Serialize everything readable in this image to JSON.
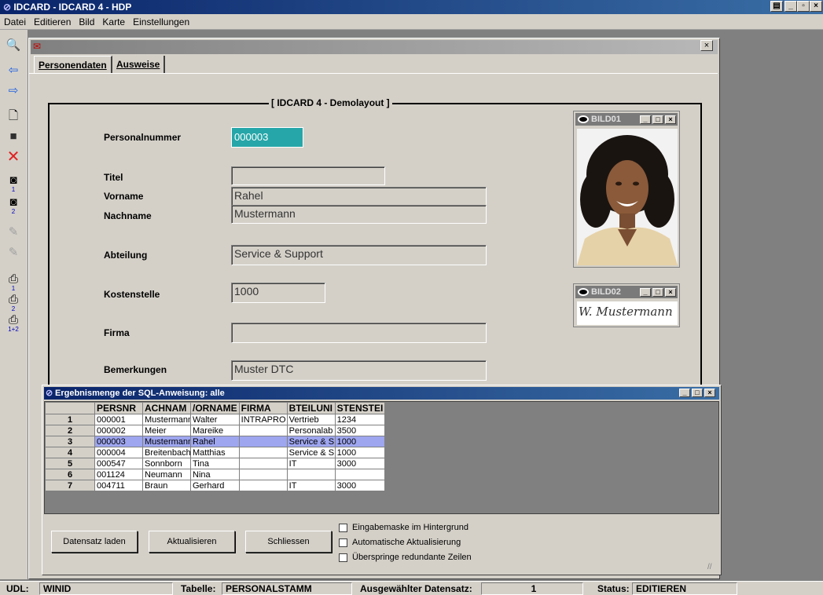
{
  "window": {
    "title": "IDCARD - IDCARD 4 - HDP"
  },
  "menu": {
    "items": [
      "Datei",
      "Editieren",
      "Bild",
      "Karte",
      "Einstellungen"
    ]
  },
  "tabs": [
    "Personendaten",
    "Ausweise"
  ],
  "form": {
    "frame_title": "[ IDCARD 4 - Demolayout ]",
    "personalnummer_label": "Personalnummer",
    "personalnummer": "000003",
    "titel_label": "Titel",
    "titel": "",
    "vorname_label": "Vorname",
    "vorname": "Rahel",
    "nachname_label": "Nachname",
    "nachname": "Mustermann",
    "abteilung_label": "Abteilung",
    "abteilung": "Service & Support",
    "kostenstelle_label": "Kostenstelle",
    "kostenstelle": "1000",
    "firma_label": "Firma",
    "firma": "",
    "bemerkungen_label": "Bemerkungen",
    "bemerkungen": "Muster DTC"
  },
  "images": {
    "bild01": "BILD01",
    "bild02": "BILD02",
    "signature": "W. Mustermann"
  },
  "dialog": {
    "title": "Ergebnismenge der SQL-Anweisung: alle",
    "columns": [
      "PERSNR",
      "ACHNAM",
      "/ORNAME",
      "FIRMA",
      "BTEILUNI",
      "STENSTEI"
    ],
    "rows": [
      [
        "1",
        "000001",
        "Mustermann",
        "Walter",
        "INTRAPRO",
        "Vertrieb",
        "1234"
      ],
      [
        "2",
        "000002",
        "Meier",
        "Mareike",
        "",
        "Personalab",
        "3500"
      ],
      [
        "3",
        "000003",
        "Mustermann",
        "Rahel",
        "",
        "Service & S",
        "1000"
      ],
      [
        "4",
        "000004",
        "Breitenbach",
        "Matthias",
        "",
        "Service & S",
        "1000"
      ],
      [
        "5",
        "000547",
        "Sonnborn",
        "Tina",
        "",
        "IT",
        "3000"
      ],
      [
        "6",
        "001124",
        "Neumann",
        "Nina",
        "",
        "",
        ""
      ],
      [
        "7",
        "004711",
        "Braun",
        "Gerhard",
        "",
        "IT",
        "3000"
      ]
    ],
    "selected_row": 2,
    "buttons": {
      "laden": "Datensatz laden",
      "aktualisieren": "Aktualisieren",
      "schliessen": "Schliessen"
    },
    "checkboxes": [
      "Eingabemaske im Hintergrund",
      "Automatische Aktualisierung",
      "Überspringe redundante Zeilen"
    ]
  },
  "status": {
    "udl_label": "UDL:",
    "udl": "WINID",
    "tabelle_label": "Tabelle:",
    "tabelle": "PERSONALSTAMM",
    "datensatz_label": "Ausgewählter Datensatz:",
    "datensatz": "1",
    "status_label": "Status:",
    "status": "EDITIEREN"
  }
}
